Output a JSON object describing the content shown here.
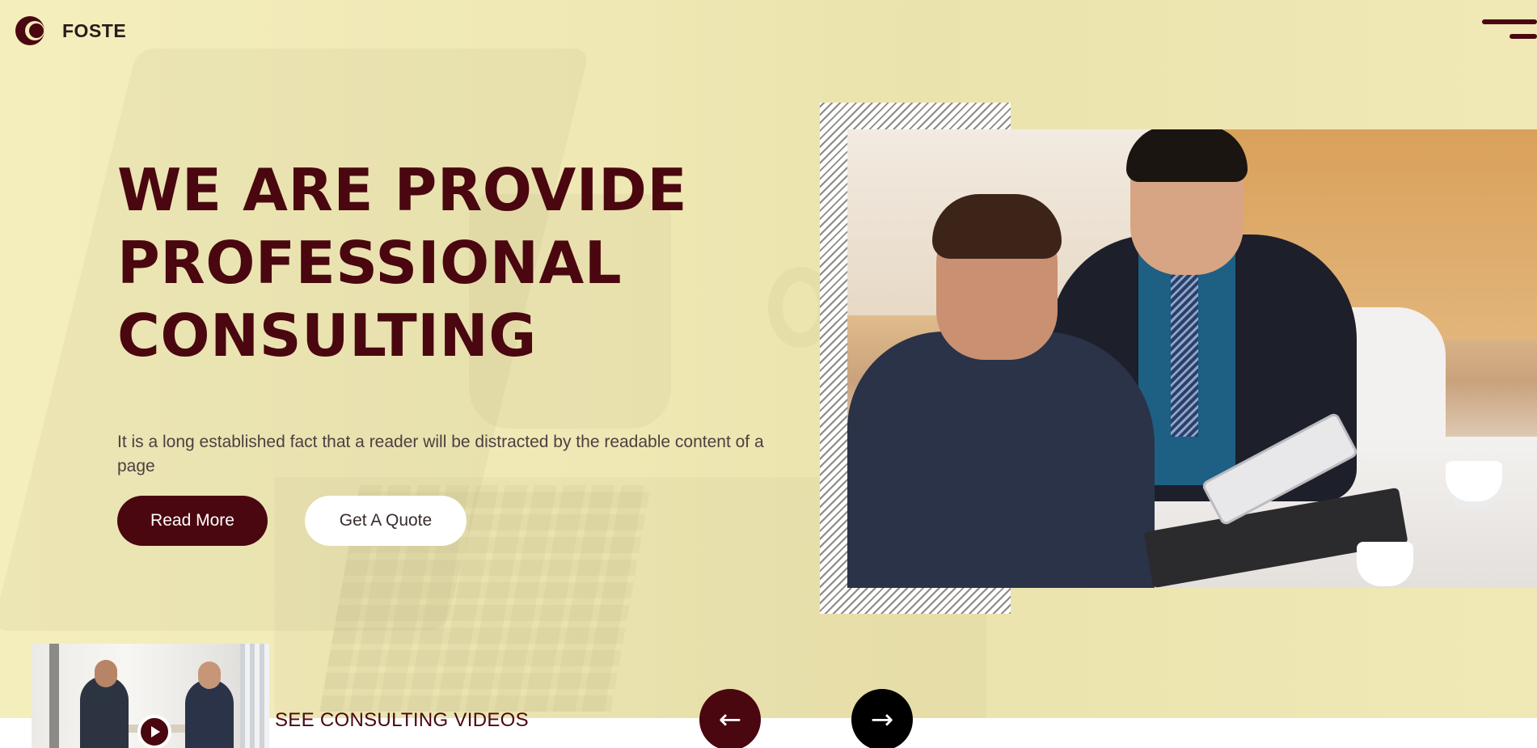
{
  "brand": {
    "name": "FOSTE",
    "logo_icon": "logo-rings-icon",
    "accent_color": "#4a0710",
    "background_color": "#f3ecb7"
  },
  "header": {
    "menu_icon": "menu-icon"
  },
  "hero": {
    "title_line1": "WE ARE PROVIDE",
    "title_line2": "PROFESSIONAL",
    "title_line3": "CONSULTING",
    "description": "It is a long established fact that a reader will be distracted by the readable content of a page",
    "primary_button": "Read More",
    "secondary_button": "Get A Quote"
  },
  "bottom": {
    "videos_label": "SEE CONSULTING VIDEOS",
    "play_icon": "play-icon",
    "prev_arrow": "←",
    "next_arrow": "→"
  }
}
